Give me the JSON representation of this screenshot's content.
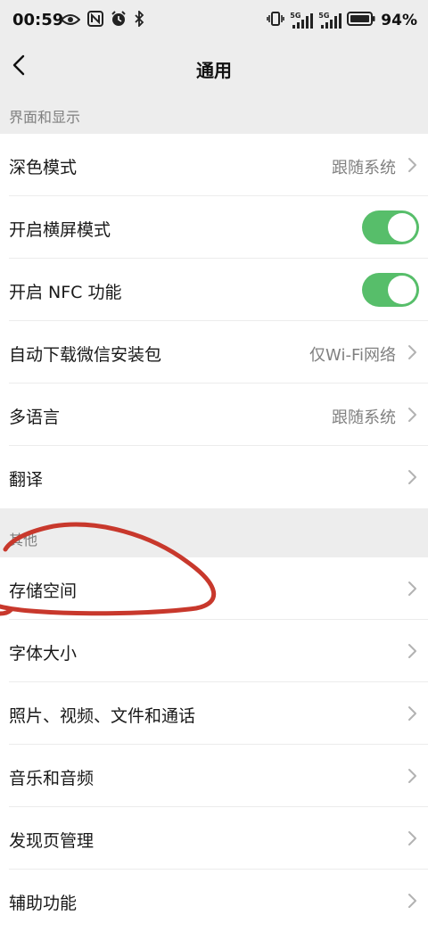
{
  "status_bar": {
    "time": "00:59",
    "battery_percent": "94%",
    "signal_1": "5G",
    "signal_2": "5G",
    "left_icons": [
      "eye-icon",
      "nfc-icon",
      "alarm-icon",
      "bluetooth-icon"
    ],
    "right_icons": [
      "vibrate-icon",
      "signal-icon",
      "signal-icon",
      "battery-icon"
    ]
  },
  "nav": {
    "back_icon": "chevron-left-icon",
    "title": "通用"
  },
  "sections": [
    {
      "header": "界面和显示",
      "rows": [
        {
          "label": "深色模式",
          "value": "跟随系统",
          "type": "link"
        },
        {
          "label": "开启横屏模式",
          "type": "toggle",
          "on": true
        },
        {
          "label": "开启 NFC 功能",
          "type": "toggle",
          "on": true
        },
        {
          "label": "自动下载微信安装包",
          "value": "仅Wi-Fi网络",
          "type": "link"
        },
        {
          "label": "多语言",
          "value": "跟随系统",
          "type": "link"
        },
        {
          "label": "翻译",
          "type": "link"
        }
      ]
    },
    {
      "header": "其他",
      "rows": [
        {
          "label": "存储空间",
          "type": "link"
        },
        {
          "label": "字体大小",
          "type": "link"
        },
        {
          "label": "照片、视频、文件和通话",
          "type": "link"
        },
        {
          "label": "音乐和音频",
          "type": "link"
        },
        {
          "label": "发现页管理",
          "type": "link"
        },
        {
          "label": "辅助功能",
          "type": "link"
        }
      ]
    }
  ],
  "colors": {
    "background": "#ededed",
    "row_background": "#ffffff",
    "toggle_on": "#57be6a",
    "annotation_red": "#c8382c",
    "secondary_text": "#808080"
  }
}
